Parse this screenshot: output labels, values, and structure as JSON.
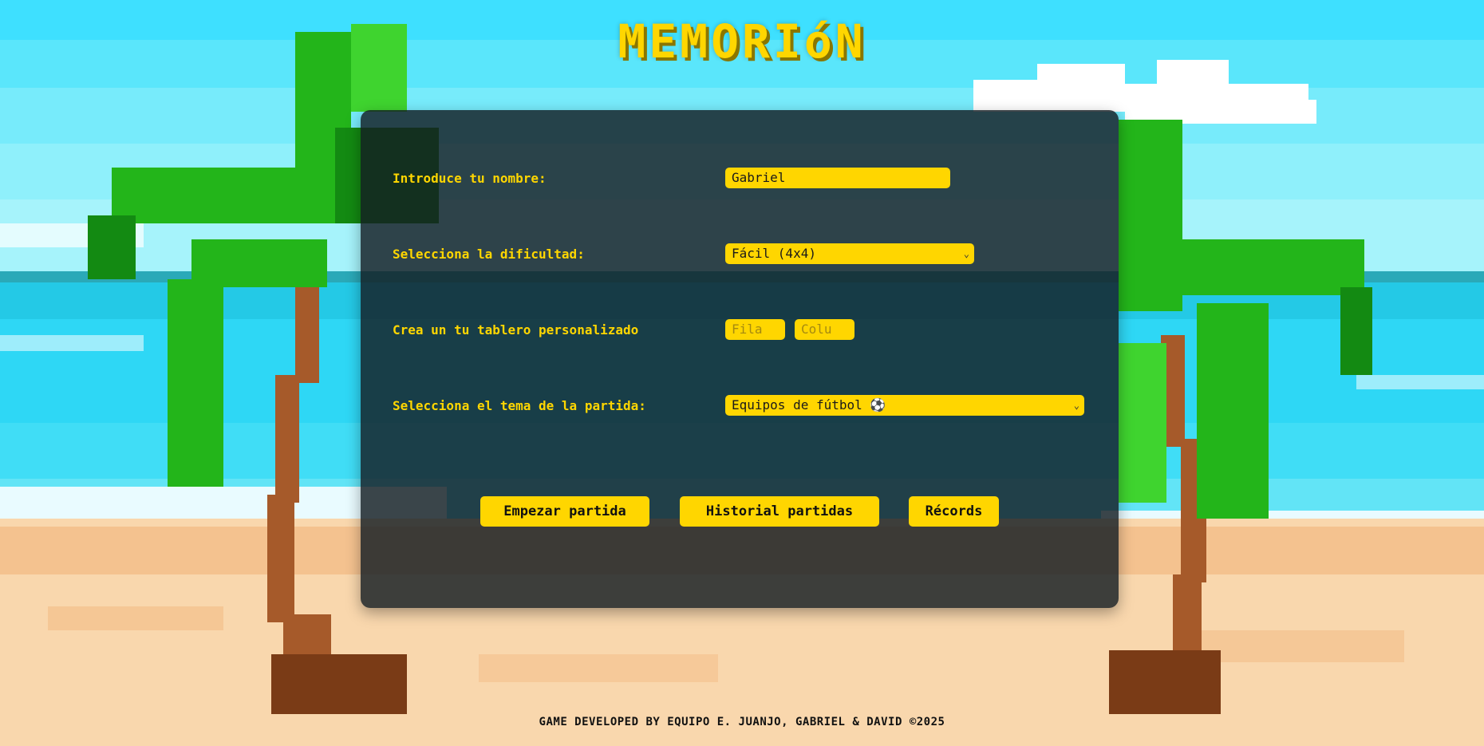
{
  "title": "MEMORIóN",
  "form": {
    "name_label": "Introduce tu nombre:",
    "name_value": "Gabriel",
    "difficulty_label": "Selecciona la dificultad:",
    "difficulty_selected": "Fácil (4x4)",
    "custom_label": "Crea un tu tablero personalizado",
    "rows_placeholder": "Fila",
    "cols_placeholder": "Colu",
    "theme_label": "Selecciona el tema de la partida:",
    "theme_selected": "Equipos de fútbol ⚽"
  },
  "buttons": {
    "start": "Empezar partida",
    "history": "Historial partidas",
    "records": "Récords"
  },
  "footer": "GAME DEVELOPED BY EQUIPO E. JUANJO, GABRIEL & DAVID ©2025",
  "colors": {
    "accent": "#ffd600",
    "panel": "#141c22",
    "sky": "#3ee0ff",
    "sand": "#f9d7ad"
  },
  "icons": {
    "dropdown": "chevron-down-icon",
    "football": "football-icon"
  }
}
